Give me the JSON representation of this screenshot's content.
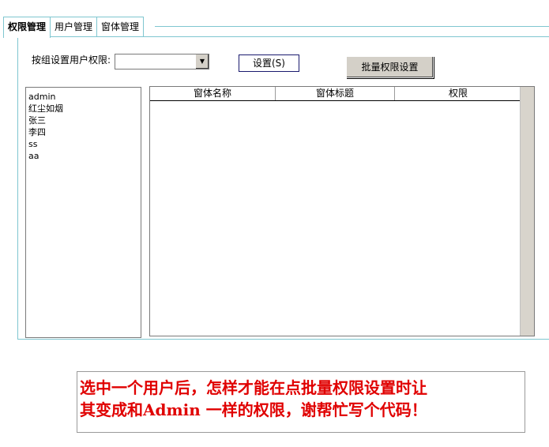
{
  "tabs": [
    {
      "label": "权限管理",
      "active": true
    },
    {
      "label": "用户管理",
      "active": false
    },
    {
      "label": "窗体管理",
      "active": false
    }
  ],
  "group_label": "按组设置用户权限:",
  "group_combo": {
    "value": ""
  },
  "set_button": "设置(S)",
  "batch_button": "批量权限设置",
  "users": [
    "admin",
    "红尘如烟",
    "张三",
    "李四",
    "ss",
    "aa"
  ],
  "grid": {
    "columns": [
      "窗体名称",
      "窗体标题",
      "权限"
    ],
    "rows": []
  },
  "note": {
    "line1": "选中一个用户后，怎样才能在点批量权限设置时让",
    "line2": "其变成和Admin 一样的权限，谢帮忙写个代码！",
    "color": "#e00000"
  },
  "colors": {
    "tab_border": "#7fc6d0",
    "button_face": "#d4d0c8"
  }
}
